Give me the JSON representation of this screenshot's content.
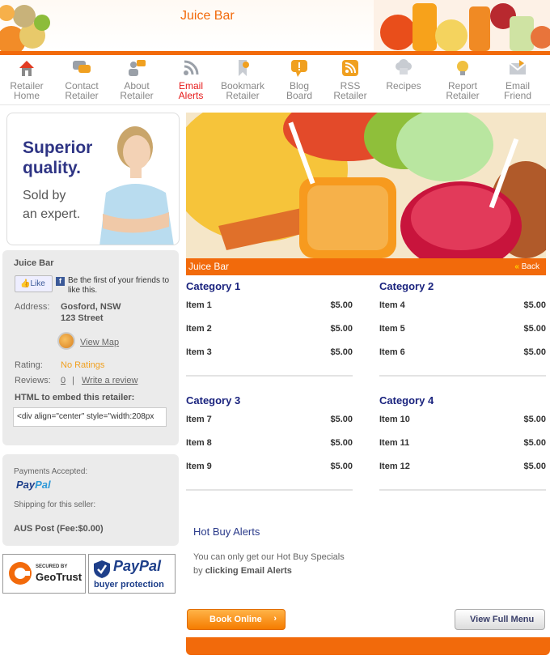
{
  "header": {
    "title": "Juice Bar"
  },
  "nav": [
    {
      "label1": "Retailer",
      "label2": "Home",
      "icon": "home-icon"
    },
    {
      "label1": "Contact",
      "label2": "Retailer",
      "icon": "chat-icon"
    },
    {
      "label1": "About",
      "label2": "Retailer",
      "icon": "people-icon"
    },
    {
      "label1": "Email",
      "label2": "Alerts",
      "icon": "rss-alert-icon"
    },
    {
      "label1": "Bookmark",
      "label2": "Retailer",
      "icon": "bookmark-icon"
    },
    {
      "label1": "Blog",
      "label2": "Board",
      "icon": "speech-bubble-icon"
    },
    {
      "label1": "RSS",
      "label2": "Retailer",
      "icon": "rss-icon"
    },
    {
      "label1": "Recipes",
      "label2": "",
      "icon": "chef-hat-icon"
    },
    {
      "label1": "Report",
      "label2": "Retailer",
      "icon": "lightbulb-icon"
    },
    {
      "label1": "Email",
      "label2": "Friend",
      "icon": "envelope-icon"
    }
  ],
  "promo": {
    "line1": "Superior",
    "line2": "quality.",
    "line3": "Sold by",
    "line4": "an expert."
  },
  "retailer": {
    "name": "Juice Bar",
    "like_label": "Like",
    "fb_text": "Be the first of your friends to like this.",
    "address_label": "Address:",
    "address_line1": "Gosford, NSW",
    "address_line2": "123 Street",
    "view_map": "View Map",
    "rating_label": "Rating:",
    "rating_value": "No Ratings",
    "reviews_label": "Reviews:",
    "reviews_count": "0",
    "reviews_sep": "|",
    "write_review": "Write a review",
    "embed_label": "HTML to embed this retailer:",
    "embed_value": "<div align=\"center\" style=\"width:208px"
  },
  "payments": {
    "accepted_label": "Payments Accepted:",
    "paypal_pay": "Pay",
    "paypal_pal": "Pal",
    "shipping_label": "Shipping for this seller:",
    "shipping_value": "AUS Post (Fee:$0.00)"
  },
  "badges": {
    "geo_small": "SECURED BY",
    "geo_name": "GeoTrust",
    "pp_name": "PayPal",
    "pp_sub": "buyer protection"
  },
  "main": {
    "title": "Juice Bar",
    "back": "Back",
    "categories": [
      {
        "title": "Category 1",
        "items": [
          {
            "name": "Item 1",
            "price": "$5.00"
          },
          {
            "name": "Item 2",
            "price": "$5.00"
          },
          {
            "name": "Item 3",
            "price": "$5.00"
          }
        ]
      },
      {
        "title": "Category 2",
        "items": [
          {
            "name": "Item 4",
            "price": "$5.00"
          },
          {
            "name": "Item 5",
            "price": "$5.00"
          },
          {
            "name": "Item 6",
            "price": "$5.00"
          }
        ]
      },
      {
        "title": "Category 3",
        "items": [
          {
            "name": "Item 7",
            "price": "$5.00"
          },
          {
            "name": "Item 8",
            "price": "$5.00"
          },
          {
            "name": "Item 9",
            "price": "$5.00"
          }
        ]
      },
      {
        "title": "Category 4",
        "items": [
          {
            "name": "Item 10",
            "price": "$5.00"
          },
          {
            "name": "Item 11",
            "price": "$5.00"
          },
          {
            "name": "Item 12",
            "price": "$5.00"
          }
        ]
      }
    ],
    "hot_title": "Hot Buy Alerts",
    "hot_line1": "You can only get our Hot Buy Specials",
    "hot_line2_prefix": "by",
    "hot_line2_bold": "clicking Email Alerts",
    "book_online": "Book Online",
    "view_full_menu": "View Full Menu"
  },
  "colors": {
    "accent": "#f26a0b",
    "navy": "#1a237e",
    "alert_red": "#e61b1b"
  }
}
